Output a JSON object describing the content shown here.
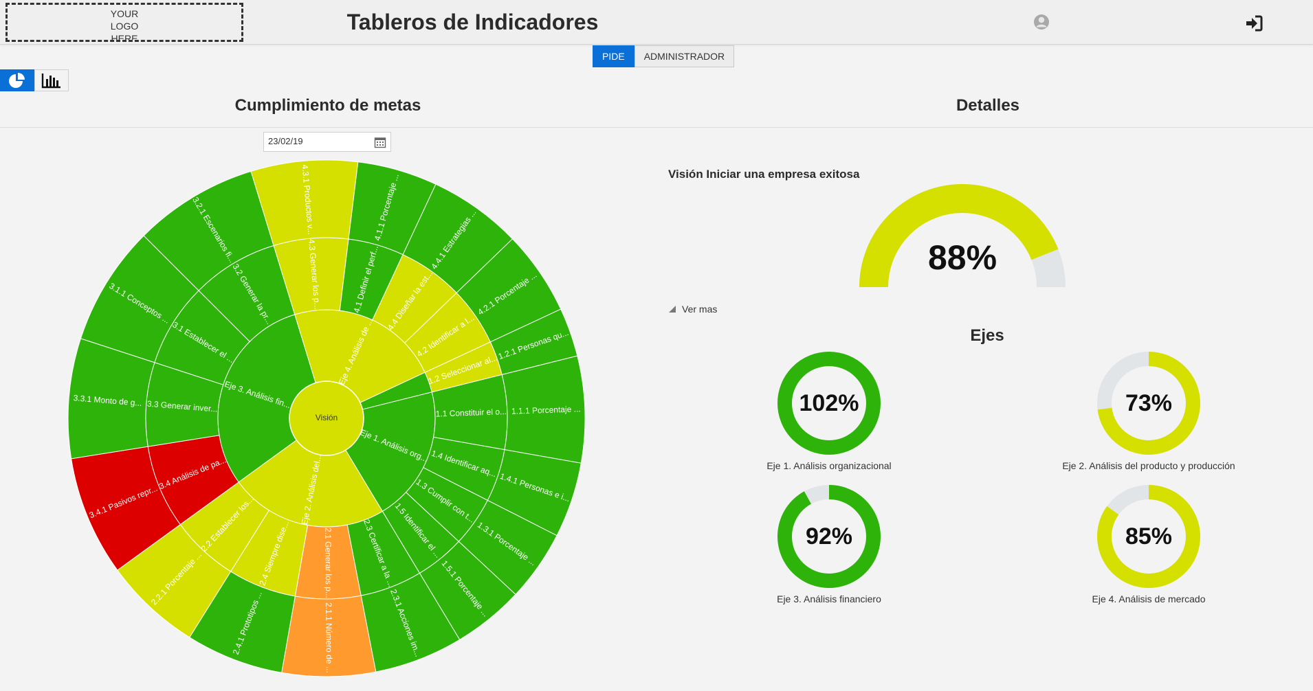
{
  "header": {
    "logo_lines": [
      "YOUR",
      "LOGO",
      "HERE"
    ],
    "title": "Tableros de Indicadores",
    "user_icon": "user-avatar-icon",
    "logout_icon": "sign-in-arrow-icon"
  },
  "tabs": [
    {
      "label": "PIDE",
      "active": true
    },
    {
      "label": "ADMINISTRADOR",
      "active": false
    }
  ],
  "view_toggle": {
    "pie_icon": "pie-chart-icon",
    "bar_icon": "bar-chart-icon",
    "active": "pie"
  },
  "left": {
    "title": "Cumplimiento de metas",
    "date_value": "23/02/19",
    "calendar_icon": "calendar-icon"
  },
  "right": {
    "title": "Detalles",
    "vision_label": "Visión Iniciar una empresa exitosa",
    "vision_percent_text": "88%",
    "vision_percent": 88,
    "ver_mas": "Ver mas",
    "ejes_title": "Ejes",
    "ejes": [
      {
        "label": "Eje 1. Análisis organizacional",
        "value_text": "102%",
        "value": 102,
        "color": "#2db30a"
      },
      {
        "label": "Eje 2. Análisis del producto y producción",
        "value_text": "73%",
        "value": 73,
        "color": "#d6e000"
      },
      {
        "label": "Eje 3. Análisis financiero",
        "value_text": "92%",
        "value": 92,
        "color": "#2db30a"
      },
      {
        "label": "Eje 4. Análisis de mercado",
        "value_text": "85%",
        "value": 85,
        "color": "#d6e000"
      }
    ]
  },
  "colors": {
    "green": "#2db30a",
    "yellow": "#d6e000",
    "orange": "#ff9a2e",
    "red": "#dd0000",
    "track": "#e2e5e8",
    "primary": "#0a6fd6"
  },
  "chart_data": {
    "type": "sunburst",
    "center_label": "Visión",
    "axes": [
      {
        "label": "Eje 1. Análisis org...",
        "color": "green",
        "children": [
          {
            "label": "1.1 Constituir el o...",
            "color": "green",
            "children": [
              {
                "label": "1.1.1 Porcentaje ...",
                "color": "green"
              }
            ]
          },
          {
            "label": "1.4 Identificar aq...",
            "color": "green",
            "children": [
              {
                "label": "1.4.1 Personas e i...",
                "color": "green"
              }
            ]
          },
          {
            "label": "1.3 Cumplir con t...",
            "color": "green",
            "children": [
              {
                "label": "1.3.1 Porcentaje ...",
                "color": "green"
              }
            ]
          },
          {
            "label": "1.5 Identificar el ...",
            "color": "green",
            "children": [
              {
                "label": "1.5.1 Porcentaje ...",
                "color": "green"
              }
            ]
          }
        ]
      },
      {
        "label": "Eje 2. Análisis del...",
        "color": "yellow",
        "children": [
          {
            "label": "2.3 Certificar a la ...",
            "color": "green",
            "children": [
              {
                "label": "2.3.1 Acciones im...",
                "color": "green"
              }
            ]
          },
          {
            "label": "2.1 Generar los p...",
            "color": "orange",
            "children": [
              {
                "label": "2.1.1 Número de ...",
                "color": "orange"
              }
            ]
          },
          {
            "label": "2.4 Siempre dise...",
            "color": "yellow",
            "children": [
              {
                "label": "2.4.1 Prototipos ...",
                "color": "green"
              }
            ]
          },
          {
            "label": "2.2 Establecer los...",
            "color": "yellow",
            "children": [
              {
                "label": "2.2.1 Porcentaje ...",
                "color": "yellow"
              }
            ]
          }
        ]
      },
      {
        "label": "Eje 3. Análisis fin...",
        "color": "green",
        "children": [
          {
            "label": "3.4 Análisis de pa...",
            "color": "red",
            "children": [
              {
                "label": "3.4.1 Pasivos repr...",
                "color": "red"
              }
            ]
          },
          {
            "label": "3.3 Generar inver...",
            "color": "green",
            "children": [
              {
                "label": "3.3.1 Monto de g...",
                "color": "green"
              }
            ]
          },
          {
            "label": "3.1 Establecer el ...",
            "color": "green",
            "children": [
              {
                "label": "3.1.1 Conceptos ...",
                "color": "green"
              }
            ]
          },
          {
            "label": "3.2 Generar la pr...",
            "color": "green",
            "children": [
              {
                "label": "3.2.1 Escenarios fi...",
                "color": "green"
              }
            ]
          }
        ]
      },
      {
        "label": "Eje 4. Análisis de ...",
        "color": "yellow",
        "children": [
          {
            "label": "4.3 Generar los p...",
            "color": "yellow",
            "children": [
              {
                "label": "4.3.1 Productos v...",
                "color": "yellow"
              }
            ]
          },
          {
            "label": "4.1 Definir el perf...",
            "color": "green",
            "children": [
              {
                "label": "4.1.1 Porcentaje ...",
                "color": "green"
              }
            ]
          },
          {
            "label": "4.4 Diseñar la est...",
            "color": "yellow",
            "children": [
              {
                "label": "4.4.1 Estrategias ...",
                "color": "green"
              }
            ]
          },
          {
            "label": "4.2 Identificar a l...",
            "color": "yellow",
            "children": [
              {
                "label": "4.2.1 Porcentaje ...",
                "color": "green"
              }
            ]
          }
        ]
      },
      {
        "label": "",
        "color": "green",
        "children": [
          {
            "label": "1.2 Seleccionar al...",
            "color": "yellow",
            "children": [
              {
                "label": "1.2.1 Personas qu...",
                "color": "green"
              }
            ]
          }
        ]
      }
    ]
  }
}
